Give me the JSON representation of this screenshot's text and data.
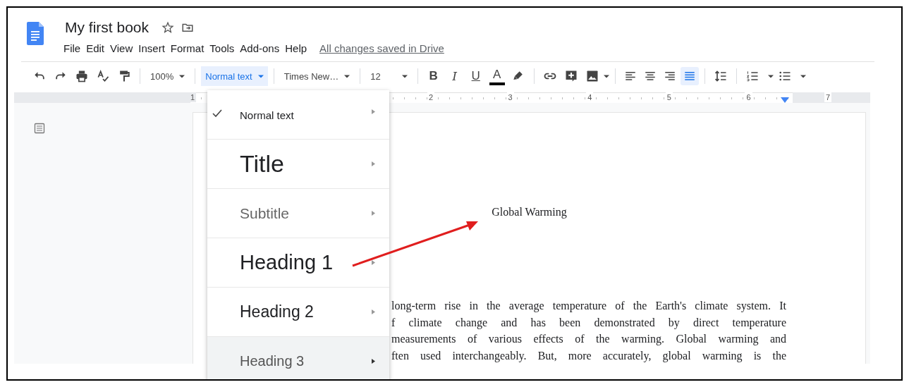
{
  "document": {
    "title": "My first book",
    "save_status": "All changes saved in Drive"
  },
  "menu_bar": [
    "File",
    "Edit",
    "View",
    "Insert",
    "Format",
    "Tools",
    "Add-ons",
    "Help"
  ],
  "toolbar": {
    "zoom": "100%",
    "style": "Normal text",
    "style_open": true,
    "font": "Times New…",
    "size": "12",
    "format_buttons": [
      {
        "kind": "bold",
        "glyph": "B"
      },
      {
        "kind": "italic",
        "glyph": "I"
      },
      {
        "kind": "underline",
        "glyph": "U"
      },
      {
        "kind": "color",
        "glyph": "A"
      }
    ],
    "alignment": [
      {
        "kind": "left",
        "selected": false
      },
      {
        "kind": "center",
        "selected": false
      },
      {
        "kind": "right",
        "selected": false
      },
      {
        "kind": "justify",
        "selected": true
      }
    ]
  },
  "ruler": {
    "labels": [
      "1",
      "2",
      "3",
      "4",
      "5",
      "6",
      "7"
    ]
  },
  "style_menu": {
    "items": [
      {
        "label": "Normal text",
        "kind": "normal",
        "checked": true,
        "highlighted": false
      },
      {
        "label": "Title",
        "kind": "title",
        "checked": false,
        "highlighted": false
      },
      {
        "label": "Subtitle",
        "kind": "subtitle",
        "checked": false,
        "highlighted": false
      },
      {
        "label": "Heading 1",
        "kind": "h1",
        "checked": false,
        "highlighted": false
      },
      {
        "label": "Heading 2",
        "kind": "h2",
        "checked": false,
        "highlighted": false
      },
      {
        "label": "Heading 3",
        "kind": "h3",
        "checked": false,
        "highlighted": true
      }
    ]
  },
  "page": {
    "heading": "Global Warming",
    "paragraph_lines": [
      "long-term rise in the average temperature of the Earth's climate system. It",
      "f climate change and has been demonstrated by direct temperature",
      "measurements of various effects of the warming. Global warming and",
      "ften used interchangeably. But, more accurately, global warming is the"
    ]
  }
}
